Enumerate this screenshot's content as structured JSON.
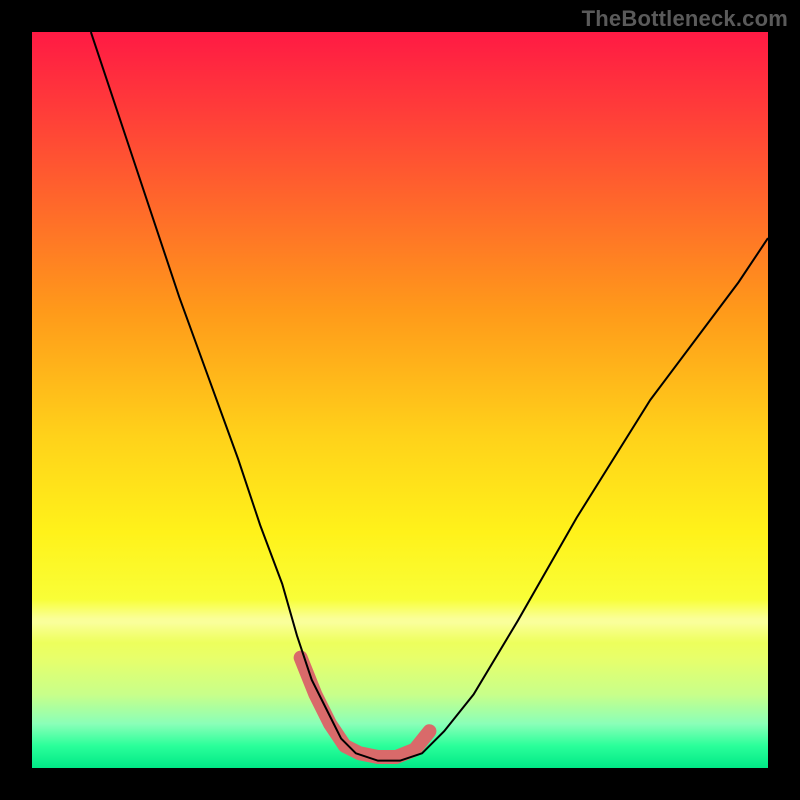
{
  "watermark": "TheBottleneck.com",
  "chart_data": {
    "type": "line",
    "title": "",
    "xlabel": "",
    "ylabel": "",
    "xlim": [
      0,
      100
    ],
    "ylim": [
      0,
      100
    ],
    "grid": false,
    "note": "Axes are implicit (no ticks or labels rendered). Values are estimated from pixel positions; y is visual height where 0=bottom, 100=top.",
    "series": [
      {
        "name": "bottleneck-curve",
        "color": "#000000",
        "stroke_width": 2,
        "x": [
          8,
          12,
          16,
          20,
          24,
          28,
          31,
          34,
          36,
          38,
          40,
          42,
          44,
          47,
          50,
          53,
          56,
          60,
          66,
          74,
          84,
          96,
          100
        ],
        "y": [
          100,
          88,
          76,
          64,
          53,
          42,
          33,
          25,
          18,
          12,
          8,
          4,
          2,
          1,
          1,
          2,
          5,
          10,
          20,
          34,
          50,
          66,
          72
        ]
      },
      {
        "name": "highlight-segment",
        "color": "#d96a6a",
        "stroke_width": 14,
        "linecap": "round",
        "x": [
          36.5,
          38.5,
          40.5,
          42.5,
          44.5,
          47,
          49.5,
          52,
          54
        ],
        "y": [
          15,
          10,
          6,
          3,
          2,
          1.5,
          1.5,
          2.5,
          5
        ]
      }
    ],
    "background_gradient": {
      "direction": "top-to-bottom",
      "stops": [
        {
          "pos": 0.0,
          "color": "#ff1a44"
        },
        {
          "pos": 0.55,
          "color": "#ffd21a"
        },
        {
          "pos": 0.82,
          "color": "#f5ff55"
        },
        {
          "pos": 1.0,
          "color": "#00e886"
        }
      ]
    }
  }
}
